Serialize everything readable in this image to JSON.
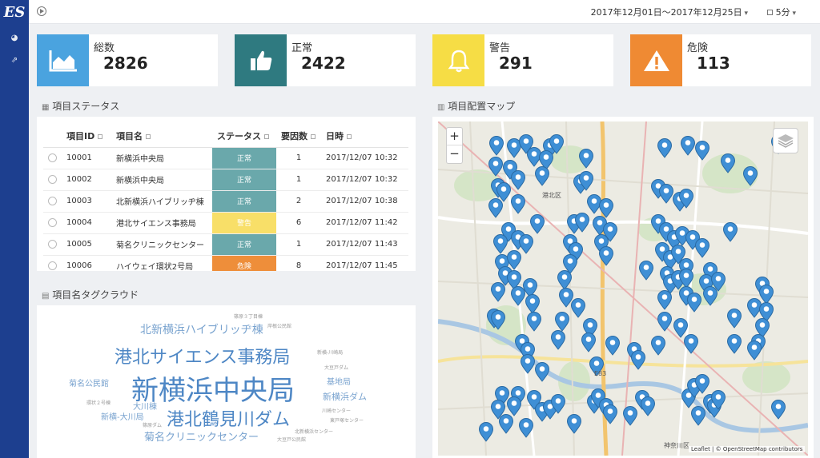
{
  "app": {
    "logo": "ES"
  },
  "topbar": {
    "date_range": "2017年12月01日〜2017年12月25日",
    "interval": "5分"
  },
  "cards": [
    {
      "label": "総数",
      "value": "2826",
      "color": "#4aa3df"
    },
    {
      "label": "正常",
      "value": "2422",
      "color": "#2f7a80"
    },
    {
      "label": "警告",
      "value": "291",
      "color": "#f6dd45"
    },
    {
      "label": "危険",
      "value": "113",
      "color": "#ef8a33"
    }
  ],
  "status_panel": {
    "title": "項目ステータス",
    "headers": [
      "項目ID",
      "項目名",
      "ステータス",
      "要因数",
      "日時"
    ],
    "rows": [
      {
        "id": "10001",
        "name": "新横浜中央局",
        "status": "正常",
        "type": "normal",
        "count": "1",
        "time": "2017/12/07 10:32"
      },
      {
        "id": "10002",
        "name": "新横浜中央局",
        "status": "正常",
        "type": "normal",
        "count": "1",
        "time": "2017/12/07 10:32"
      },
      {
        "id": "10003",
        "name": "北新横浜ハイブリッヂ棟",
        "status": "正常",
        "type": "normal",
        "count": "2",
        "time": "2017/12/07 10:38"
      },
      {
        "id": "10004",
        "name": "港北サイエンス事務局",
        "status": "警告",
        "type": "warn",
        "count": "6",
        "time": "2017/12/07 11:42"
      },
      {
        "id": "10005",
        "name": "菊名クリニックセンター",
        "status": "正常",
        "type": "normal",
        "count": "1",
        "time": "2017/12/07 11:43"
      },
      {
        "id": "10006",
        "name": "ハイウェイ環状2号局",
        "status": "危険",
        "type": "danger",
        "count": "8",
        "time": "2017/12/07 11:45"
      }
    ]
  },
  "tagcloud": {
    "title": "項目名タグクラウド",
    "tags": [
      {
        "text": "篠原３丁目棟",
        "size": 6
      },
      {
        "text": "北新横浜ハイブリッヂ棟",
        "size": 14
      },
      {
        "text": "岸根公民館",
        "size": 6
      },
      {
        "text": "港北サイエンス事務局",
        "size": 22
      },
      {
        "text": "新横-川崎局",
        "size": 6
      },
      {
        "text": "大豆戸ダム",
        "size": 6
      },
      {
        "text": "菊名公民館",
        "size": 10
      },
      {
        "text": "新横浜中央局",
        "size": 34
      },
      {
        "text": "基地局",
        "size": 10
      },
      {
        "text": "新横浜ダム",
        "size": 11
      },
      {
        "text": "環状２号棟",
        "size": 6
      },
      {
        "text": "大川棟",
        "size": 10
      },
      {
        "text": "川崎センター",
        "size": 6
      },
      {
        "text": "新横-大川局",
        "size": 10
      },
      {
        "text": "港北鶴見川ダム",
        "size": 22
      },
      {
        "text": "東戸塚センター",
        "size": 6
      },
      {
        "text": "篠原ダム",
        "size": 6
      },
      {
        "text": "北新横浜センター",
        "size": 6
      },
      {
        "text": "菊名クリニックセンター",
        "size": 13
      },
      {
        "text": "大豆戸公民館",
        "size": 6
      }
    ]
  },
  "map": {
    "title": "項目配置マップ",
    "zoom_in": "+",
    "zoom_out": "−",
    "attribution": "Leaflet | © OpenStreetMap contributors",
    "labels": [
      "港北区",
      "神奈川区",
      "E83"
    ]
  }
}
